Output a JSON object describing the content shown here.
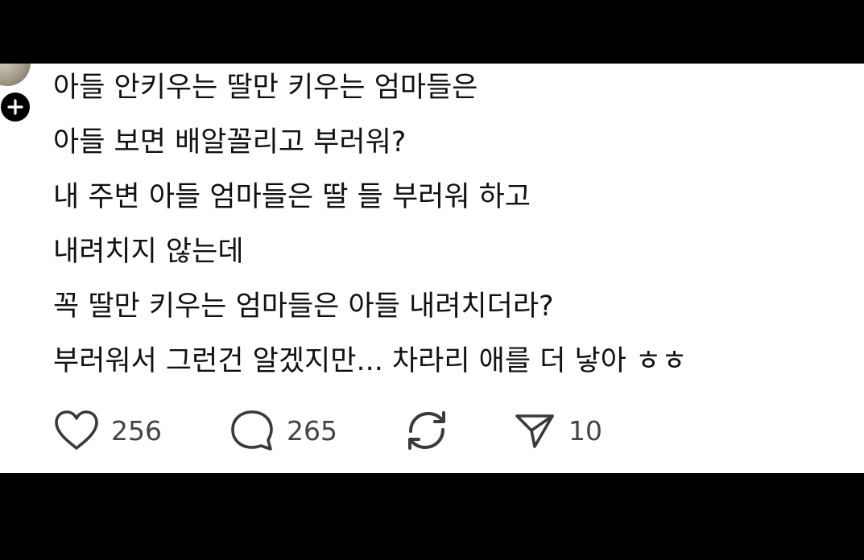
{
  "post": {
    "lines": [
      "아들 안키우는 딸만 키우는 엄마들은",
      "아들 보면 배알꼴리고 부러워?",
      "내 주변 아들 엄마들은 딸 들 부러워 하고",
      "내려치지 않는데",
      "꼭 딸만 키우는 엄마들은 아들 내려치더라?",
      "부러워서 그런건 알겠지만... 차라리 애를 더 낳아 ㅎㅎ"
    ]
  },
  "actions": {
    "like": {
      "icon": "heart-icon",
      "count": "256"
    },
    "reply": {
      "icon": "speech-bubble-icon",
      "count": "265"
    },
    "repost": {
      "icon": "repost-icon"
    },
    "share": {
      "icon": "send-icon",
      "count": "10"
    }
  },
  "colors": {
    "background": "#ffffff",
    "text": "#111111",
    "icon": "#3a3a3a",
    "frame": "#000000"
  }
}
